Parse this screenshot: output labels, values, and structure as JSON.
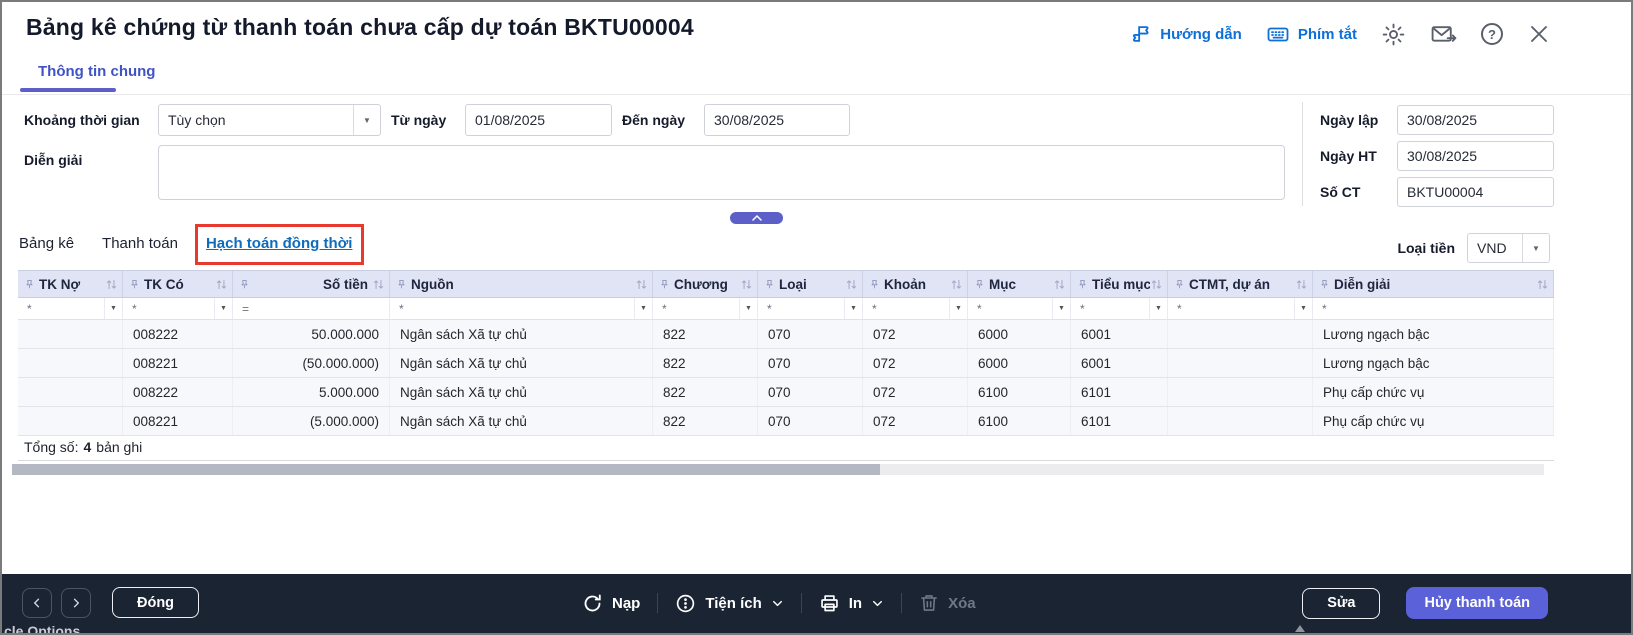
{
  "header": {
    "title": "Bảng kê chứng từ thanh toán chưa cấp dự toán BKTU00004",
    "guide_label": "Hướng dẫn",
    "shortcuts_label": "Phím tắt"
  },
  "main_tab_label": "Thông tin chung",
  "form": {
    "period_label": "Khoảng thời gian",
    "period_value": "Tùy chọn",
    "from_label": "Từ ngày",
    "from_value": "01/08/2025",
    "to_label": "Đến ngày",
    "to_value": "30/08/2025",
    "description_label": "Diễn giải",
    "description_value": "",
    "created_date_label": "Ngày lập",
    "created_date_value": "30/08/2025",
    "posting_date_label": "Ngày HT",
    "posting_date_value": "30/08/2025",
    "doc_number_label": "Số CT",
    "doc_number_value": "BKTU00004"
  },
  "detail_tab_labels": [
    "Bảng kê",
    "Thanh toán",
    "Hạch toán đồng thời"
  ],
  "currency": {
    "label": "Loại tiền",
    "value": "VND"
  },
  "table": {
    "columns": [
      "TK Nợ",
      "TK Có",
      "Số tiền",
      "Nguồn",
      "Chương",
      "Loại",
      "Khoản",
      "Mục",
      "Tiểu mục",
      "CTMT, dự án",
      "Diễn giải"
    ],
    "filter_operators": [
      "*",
      "*",
      "=",
      "*",
      "*",
      "*",
      "*",
      "*",
      "*",
      "*",
      "*"
    ],
    "filter_dropdowns": [
      true,
      true,
      false,
      true,
      true,
      true,
      true,
      true,
      true,
      true,
      false
    ],
    "rows": [
      [
        "",
        "008222",
        "50.000.000",
        "Ngân sách Xã tự chủ",
        "822",
        "070",
        "072",
        "6000",
        "6001",
        "",
        "Lương ngạch bậc"
      ],
      [
        "",
        "008221",
        "(50.000.000)",
        "Ngân sách Xã tự chủ",
        "822",
        "070",
        "072",
        "6000",
        "6001",
        "",
        "Lương ngạch bậc"
      ],
      [
        "",
        "008222",
        "5.000.000",
        "Ngân sách Xã tự chủ",
        "822",
        "070",
        "072",
        "6100",
        "6101",
        "",
        "Phụ cấp chức vụ"
      ],
      [
        "",
        "008221",
        "(5.000.000)",
        "Ngân sách Xã tự chủ",
        "822",
        "070",
        "072",
        "6100",
        "6101",
        "",
        "Phụ cấp chức vụ"
      ]
    ],
    "summary": {
      "prefix": "Tổng số:",
      "count": "4",
      "suffix": "bản ghi"
    }
  },
  "toolbar": {
    "close_label": "Đóng",
    "reload_label": "Nạp",
    "utilities_label": "Tiện ích",
    "print_label": "In",
    "delete_label": "Xóa",
    "edit_label": "Sửa",
    "cancel_payment_label": "Hủy thanh toán"
  },
  "artifacts": {
    "clipped_text": "cle Options"
  },
  "colors": {
    "link_blue": "#0d6fd8",
    "tab_blue": "#0f6cbd",
    "accent_indigo": "#5b5fc7",
    "annotation_red": "#e8392f",
    "toolbar_bg": "#1b2433",
    "primary_button": "#5b61d8"
  }
}
